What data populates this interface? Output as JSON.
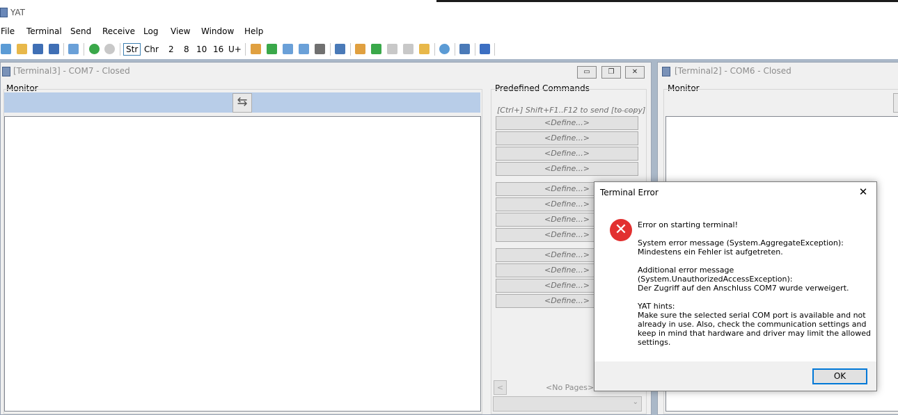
{
  "app": {
    "title": "YAT"
  },
  "menu": [
    "File",
    "Terminal",
    "Send",
    "Receive",
    "Log",
    "View",
    "Window",
    "Help"
  ],
  "toolbar": {
    "radix": [
      "Str",
      "Chr",
      "2",
      "8",
      "10",
      "16",
      "U+"
    ]
  },
  "terminal3": {
    "title": "[Terminal3] - COM7 - Closed",
    "monitor_label": "Monitor",
    "predefined_label": "Predefined Commands",
    "predefined_hint": "[Ctrl+] Shift+F1..F12 to send [to copy]",
    "define_label": "<Define...>",
    "no_pages": "<No Pages>"
  },
  "terminal2": {
    "title": "[Terminal2] - COM6 - Closed",
    "monitor_label": "Monitor"
  },
  "dialog": {
    "title": "Terminal Error",
    "line1": "Error on starting terminal!",
    "sys_msg": "System error message (System.AggregateException):\nMindestens ein Fehler ist aufgetreten.",
    "add_msg": "Additional error message\n(System.UnauthorizedAccessException):\nDer Zugriff auf den Anschluss COM7 wurde verweigert.",
    "hints": "YAT hints:\nMake sure the selected serial COM port is available and not\nalready in use. Also, check the communication settings and\nkeep in mind that hardware and driver may limit the allowed\nsettings.",
    "ok": "OK"
  }
}
